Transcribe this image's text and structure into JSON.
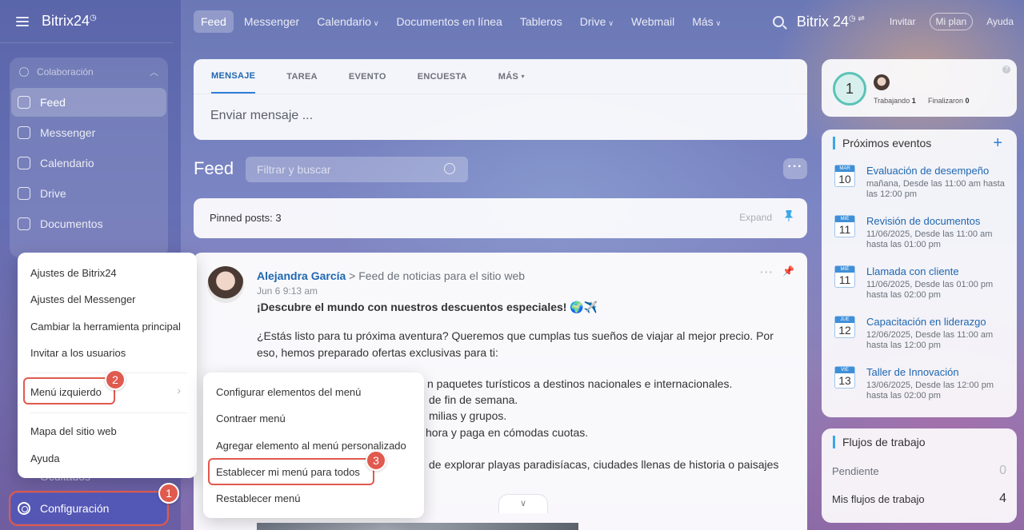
{
  "sidebar": {
    "logo": "Bitrix24",
    "group_label": "Colaboración",
    "items": [
      {
        "label": "Feed"
      },
      {
        "label": "Messenger"
      },
      {
        "label": "Calendario"
      },
      {
        "label": "Drive"
      },
      {
        "label": "Documentos"
      }
    ],
    "hidden_label": "Ocultados",
    "config_label": "Configuración"
  },
  "topbar": {
    "nav": [
      "Feed",
      "Messenger",
      "Calendario",
      "Documentos en línea",
      "Tableros",
      "Drive",
      "Webmail",
      "Más"
    ],
    "brand": "Bitrix 24",
    "invite": "Invitar",
    "plan": "Mi plan",
    "help": "Ayuda"
  },
  "composer": {
    "tabs": [
      "MENSAJE",
      "TAREA",
      "EVENTO",
      "ENCUESTA",
      "MÁS"
    ],
    "placeholder": "Enviar mensaje ..."
  },
  "feed": {
    "title": "Feed",
    "filter_placeholder": "Filtrar y buscar",
    "pinned_label": "Pinned posts: 3",
    "expand_label": "Expand"
  },
  "post": {
    "author": "Alejandra García",
    "destination": "Feed de noticias para el sitio web",
    "date": "Jun 6 9:13 am",
    "headline": "¡Descubre el mundo con nuestros descuentos especiales! 🌍✈️",
    "intro": "¿Estás listo para tu próxima aventura? Queremos que cumplas tus sueños de viajar al mejor precio. Por eso, hemos preparado ofertas exclusivas para ti:",
    "line1": "n paquetes turísticos a destinos nacionales e internacionales.",
    "line2": "de fin de semana.",
    "line3": "milias y grupos.",
    "line4": "hora y paga en cómodas cuotas.",
    "line5": "de explorar playas paradisíacas, ciudades llenas de historia o paisajes"
  },
  "work_widget": {
    "count": "1",
    "working_label": "Trabajando",
    "working_count": "1",
    "finished_label": "Finalizaron",
    "finished_count": "0"
  },
  "events": {
    "title": "Próximos eventos",
    "items": [
      {
        "month": "MAR",
        "day": "10",
        "title": "Evaluación de desempeño",
        "time": "mañana, Desde las 11:00 am hasta las 12:00 pm"
      },
      {
        "month": "MIÉ",
        "day": "11",
        "title": "Revisión de documentos",
        "time": "11/06/2025, Desde las 11:00 am hasta las 01:00 pm"
      },
      {
        "month": "MIÉ",
        "day": "11",
        "title": "Llamada con cliente",
        "time": "11/06/2025, Desde las 01:00 pm hasta las 02:00 pm"
      },
      {
        "month": "JUE",
        "day": "12",
        "title": "Capacitación en liderazgo",
        "time": "12/06/2025, Desde las 11:00 am hasta las 12:00 pm"
      },
      {
        "month": "VIE",
        "day": "13",
        "title": "Taller de Innovación",
        "time": "13/06/2025, Desde las 12:00 pm hasta las 02:00 pm"
      }
    ]
  },
  "workflows": {
    "title": "Flujos de trabajo",
    "pending_label": "Pendiente",
    "pending_count": "0",
    "mine_label": "Mis flujos de trabajo",
    "mine_count": "4"
  },
  "settings_menu": {
    "items": [
      "Ajustes de Bitrix24",
      "Ajustes del Messenger",
      "Cambiar la herramienta principal",
      "Invitar a los usuarios",
      "Menú izquierdo",
      "Mapa del sitio web",
      "Ayuda"
    ]
  },
  "left_menu_submenu": {
    "items": [
      "Configurar elementos del menú",
      "Contraer menú",
      "Agregar elemento al menú personalizado",
      "Establecer mi menú para todos",
      "Restablecer menú"
    ]
  },
  "badges": [
    "1",
    "2",
    "3"
  ],
  "colors": {
    "accent": "#2067b0",
    "highlight": "#e05a4f",
    "teal": "#5bc3b8"
  }
}
